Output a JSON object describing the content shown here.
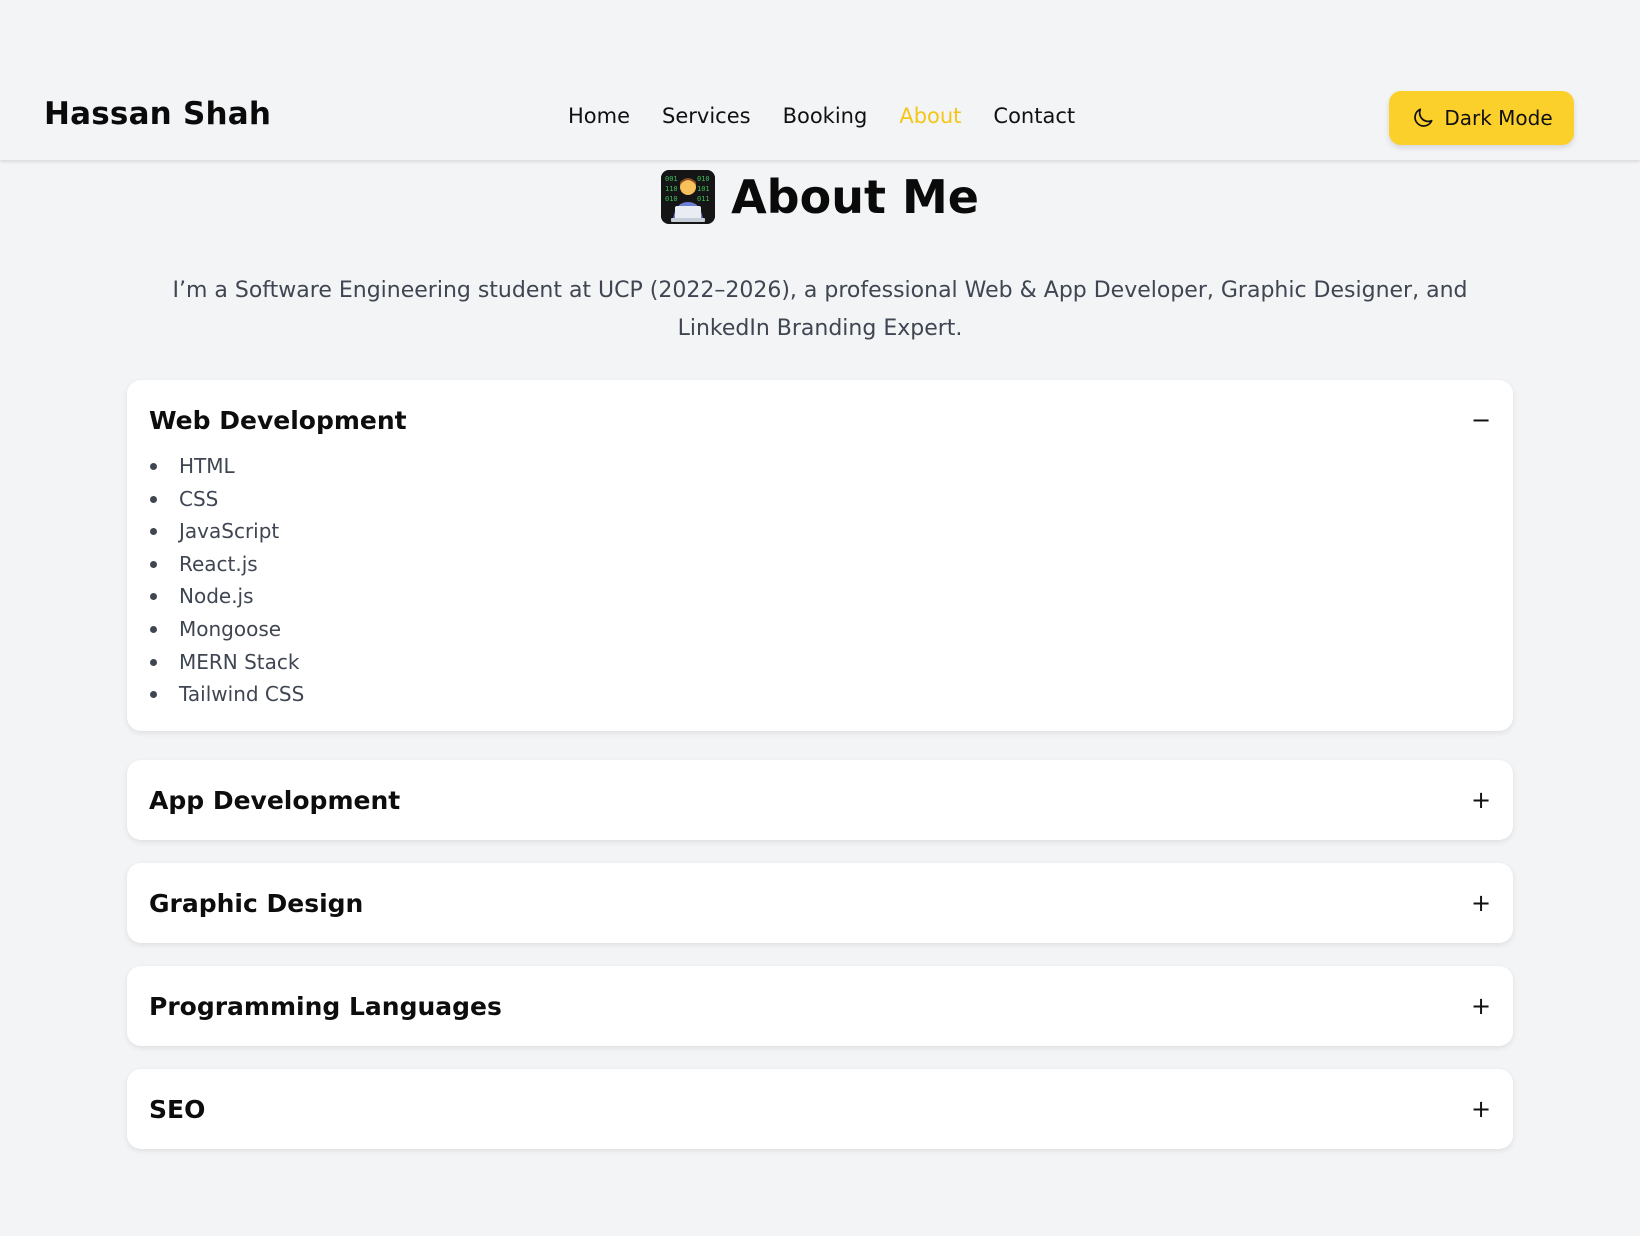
{
  "navbar": {
    "brand": "Hassan Shah",
    "links": [
      "Home",
      "Services",
      "Booking",
      "About",
      "Contact"
    ],
    "active_link": "About",
    "dark_mode_label": "Dark Mode",
    "accent_color": "#fcd02a"
  },
  "about": {
    "title": "About Me",
    "title_icon": "technologist-emoji-icon",
    "intro": "I’m a Software Engineering student at UCP (2022–2026), a professional Web & App Developer, Graphic Designer, and LinkedIn Branding Expert."
  },
  "accordion": [
    {
      "title": "Web Development",
      "toggle": "−",
      "expanded": true,
      "items": [
        "HTML",
        "CSS",
        "JavaScript",
        "React.js",
        "Node.js",
        "Mongoose",
        "MERN Stack",
        "Tailwind CSS"
      ]
    },
    {
      "title": "App Development",
      "toggle": "+",
      "expanded": false
    },
    {
      "title": "Graphic Design",
      "toggle": "+",
      "expanded": false
    },
    {
      "title": "Programming Languages",
      "toggle": "+",
      "expanded": false
    },
    {
      "title": "SEO",
      "toggle": "+",
      "expanded": false
    }
  ]
}
